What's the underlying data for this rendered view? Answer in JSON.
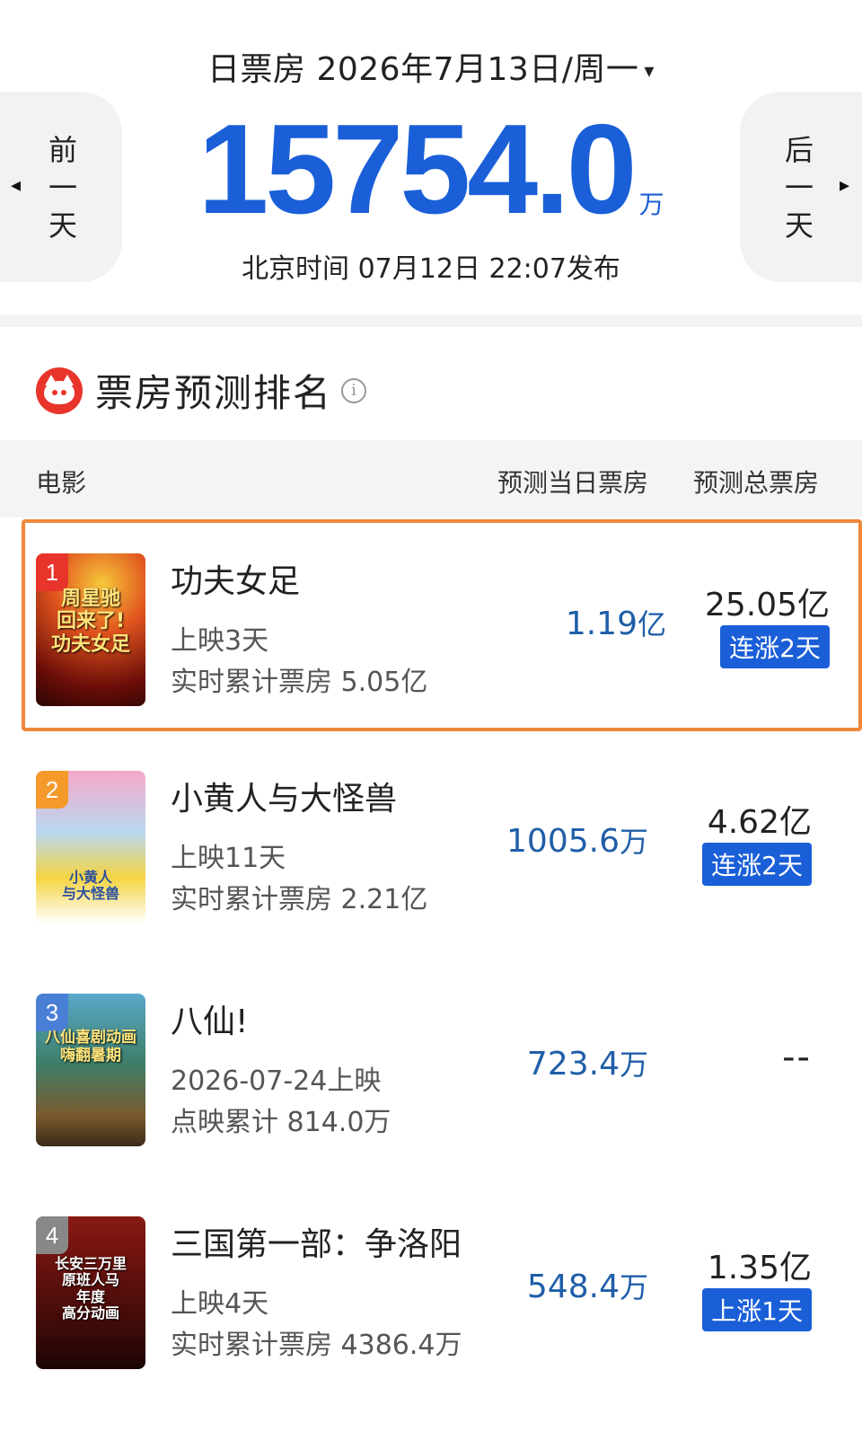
{
  "header": {
    "date_label": "日票房 2026年7月13日/周一",
    "caret": "▾",
    "prev_label": "前\n一\n天",
    "next_label": "后\n一\n天",
    "prev_arrow": "◂",
    "next_arrow": "▸",
    "total_value": "15754.0",
    "total_unit": "万",
    "publish_text": "北京时间  07月12日  22:07发布"
  },
  "section": {
    "title": "票房预测排名",
    "info_glyph": "i"
  },
  "table": {
    "col_movie": "电影",
    "col_daily": "预测当日票房",
    "col_total": "预测总票房"
  },
  "movies": [
    {
      "rank": "1",
      "name": "功夫女足",
      "line1": "上映3天",
      "line2": "实时累计票房 5.05亿",
      "daily_value": "1.19",
      "daily_unit": "亿",
      "total": "25.05亿",
      "badge": "连涨2天",
      "poster_text": "周星驰\n回来了!\n功夫女足",
      "rank_color": "#e8342a"
    },
    {
      "rank": "2",
      "name": "小黄人与大怪兽",
      "line1": "上映11天",
      "line2": "实时累计票房 2.21亿",
      "daily_value": "1005.6",
      "daily_unit": "万",
      "total": "4.62亿",
      "badge": "连涨2天",
      "poster_text": "小黄人\n与大怪兽",
      "rank_color": "#f39a2b"
    },
    {
      "rank": "3",
      "name": "八仙!",
      "line1": "2026-07-24上映",
      "line2": "点映累计 814.0万",
      "daily_value": "723.4",
      "daily_unit": "万",
      "total": "--",
      "badge": "",
      "poster_text": "八仙喜剧动画\n嗨翻暑期",
      "rank_color": "#4a7fd6"
    },
    {
      "rank": "4",
      "name": "三国第一部：争洛阳",
      "line1": "上映4天",
      "line2": "实时累计票房 4386.4万",
      "daily_value": "548.4",
      "daily_unit": "万",
      "total": "1.35亿",
      "badge": "上涨1天",
      "poster_text": "长安三万里\n原班人马\n年度\n高分动画",
      "rank_color": "#888888"
    }
  ],
  "colors": {
    "accent_blue": "#1a5fd8",
    "daily_blue": "#1f5ea8",
    "highlight_border": "#f0883a",
    "logo_red": "#e8342a"
  }
}
